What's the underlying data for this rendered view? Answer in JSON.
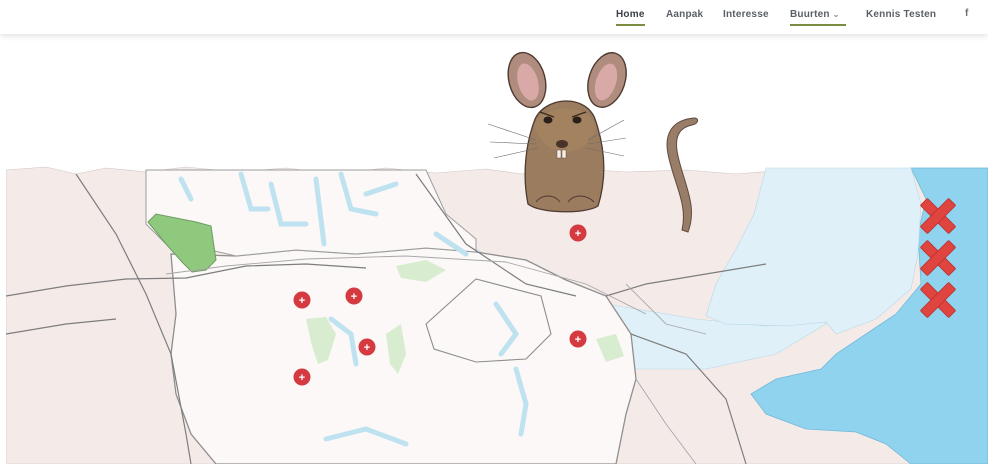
{
  "nav": {
    "items": [
      {
        "label": "Home",
        "active": true
      },
      {
        "label": "Aanpak"
      },
      {
        "label": "Interesse"
      },
      {
        "label": "Buurten",
        "has_dropdown": true
      },
      {
        "label": "Kennis Testen"
      }
    ],
    "social_icon": "facebook-icon",
    "social_label": "f"
  },
  "map": {
    "markers": [
      "+",
      "+",
      "+",
      "+",
      "+",
      "+"
    ],
    "marker_color": "#d43a3f",
    "flag_color": "#e0443f",
    "water_color": "#8fd3ef",
    "land_color": "#f4ebe9"
  },
  "colors": {
    "accent": "#7a8c3f",
    "nav_text": "#5a5f66"
  }
}
